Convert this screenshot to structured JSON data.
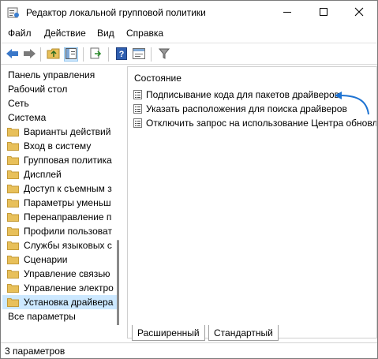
{
  "window": {
    "title": "Редактор локальной групповой политики",
    "app_icon": "gpedit-icon",
    "controls": {
      "minimize": "minimize-icon",
      "maximize": "maximize-icon",
      "close": "close-icon"
    }
  },
  "menu": {
    "items": [
      "Файл",
      "Действие",
      "Вид",
      "Справка"
    ]
  },
  "toolbar": {
    "icons": [
      "back-arrow-icon",
      "forward-arrow-icon",
      "up-folder-icon",
      "show-hide-tree-icon",
      "export-list-icon",
      "help-icon",
      "properties-icon",
      "filter-icon"
    ]
  },
  "tree": {
    "items": [
      {
        "label": "Панель управления",
        "type": "plain"
      },
      {
        "label": "Рабочий стол",
        "type": "plain"
      },
      {
        "label": "Сеть",
        "type": "plain"
      },
      {
        "label": "Система",
        "type": "plain"
      },
      {
        "label": "Варианты действий",
        "type": "folder"
      },
      {
        "label": "Вход в систему",
        "type": "folder"
      },
      {
        "label": "Групповая политика",
        "type": "folder"
      },
      {
        "label": "Дисплей",
        "type": "folder"
      },
      {
        "label": "Доступ к съемным з",
        "type": "folder"
      },
      {
        "label": "Параметры уменьш",
        "type": "folder"
      },
      {
        "label": "Перенаправление п",
        "type": "folder"
      },
      {
        "label": "Профили пользоват",
        "type": "folder"
      },
      {
        "label": "Службы языковых с",
        "type": "folder"
      },
      {
        "label": "Сценарии",
        "type": "folder"
      },
      {
        "label": "Управление связью",
        "type": "folder"
      },
      {
        "label": "Управление электро",
        "type": "folder"
      },
      {
        "label": "Установка драйвера",
        "type": "folder",
        "selected": true
      },
      {
        "label": "Все параметры",
        "type": "plain"
      }
    ]
  },
  "details": {
    "column_header": "Состояние",
    "policies": [
      "Подписывание кода для пакетов драйверов",
      "Указать расположения для поиска драйверов",
      "Отключить запрос на использование Центра обновл"
    ]
  },
  "tabs": [
    "Расширенный",
    "Стандартный"
  ],
  "status": {
    "text": "3 параметров"
  },
  "colors": {
    "selection": "#cce8ff",
    "annotation_arrow": "#1e73d2",
    "folder": "#e8c05a"
  }
}
